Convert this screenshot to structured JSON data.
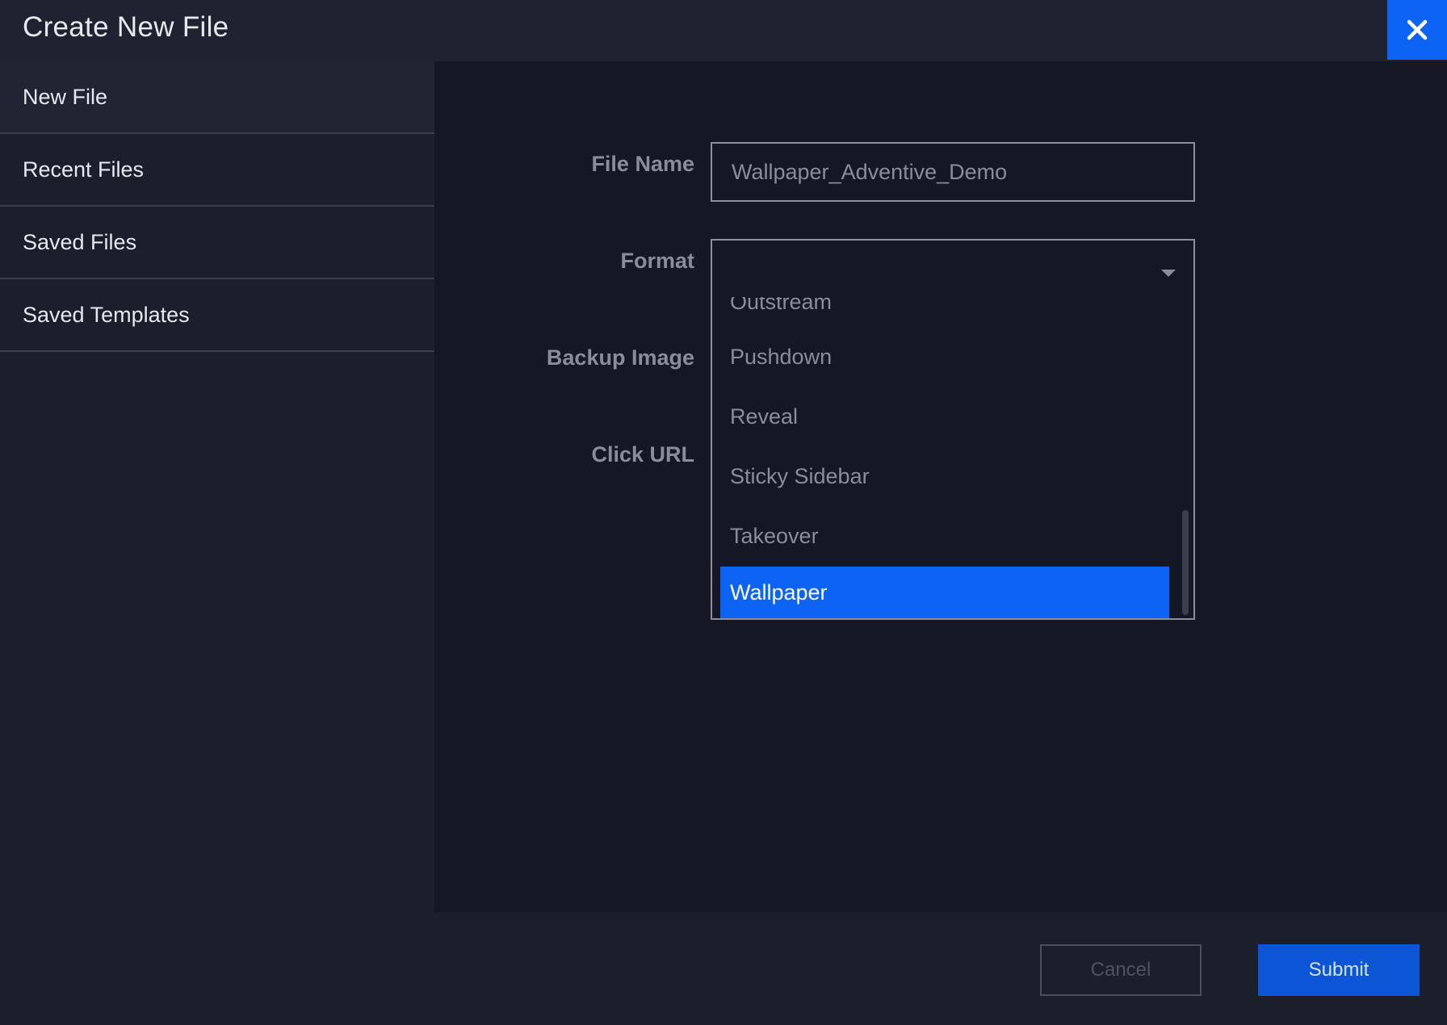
{
  "dialog": {
    "title": "Create New File"
  },
  "sidebar": {
    "items": [
      {
        "label": "New File",
        "active": true
      },
      {
        "label": "Recent Files",
        "active": false
      },
      {
        "label": "Saved Files",
        "active": false
      },
      {
        "label": "Saved Templates",
        "active": false
      }
    ]
  },
  "form": {
    "file_name_label": "File Name",
    "file_name_value": "Wallpaper_Adventive_Demo",
    "format_label": "Format",
    "backup_image_label": "Backup Image",
    "click_url_label": "Click URL"
  },
  "format_dropdown": {
    "options": [
      "Outstream",
      "Pushdown",
      "Reveal",
      "Sticky Sidebar",
      "Takeover",
      "Wallpaper"
    ],
    "selected": "Wallpaper"
  },
  "footer": {
    "cancel_label": "Cancel",
    "submit_label": "Submit"
  },
  "colors": {
    "accent": "#0d63f3",
    "background": "#1b1e2b",
    "panel": "#151824"
  },
  "icons": {
    "close": "close-icon",
    "dropdown": "chevron-down-icon"
  }
}
